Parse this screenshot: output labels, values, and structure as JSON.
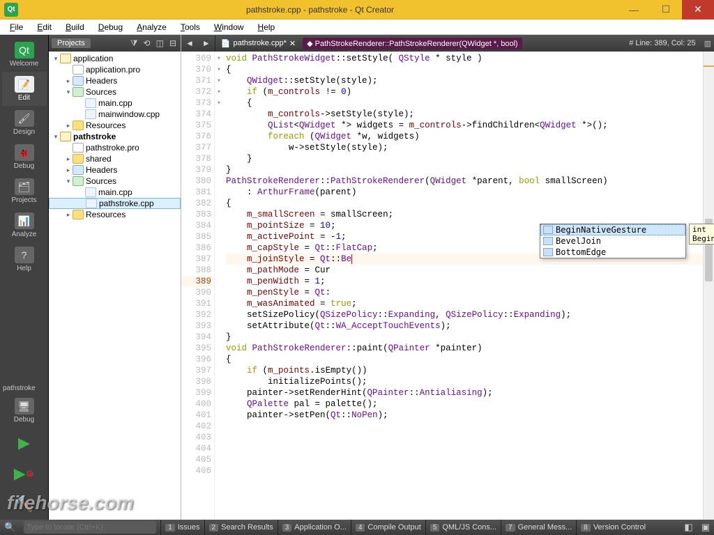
{
  "window": {
    "title": "pathstroke.cpp - pathstroke - Qt Creator"
  },
  "menu": [
    "File",
    "Edit",
    "Build",
    "Debug",
    "Analyze",
    "Tools",
    "Window",
    "Help"
  ],
  "modebar": {
    "items": [
      {
        "label": "Welcome",
        "key": "welcome"
      },
      {
        "label": "Edit",
        "key": "edit",
        "active": true
      },
      {
        "label": "Design",
        "key": "design"
      },
      {
        "label": "Debug",
        "key": "debug"
      },
      {
        "label": "Projects",
        "key": "projects"
      },
      {
        "label": "Analyze",
        "key": "analyze"
      },
      {
        "label": "Help",
        "key": "help"
      }
    ],
    "project_label": "pathstroke",
    "build_config": "Debug"
  },
  "projpanel": {
    "selector": "Projects",
    "tree": [
      {
        "d": 0,
        "t": "application",
        "arr": "▾",
        "ic": "proj"
      },
      {
        "d": 1,
        "t": "application.pro",
        "arr": "",
        "ic": "pro"
      },
      {
        "d": 1,
        "t": "Headers",
        "arr": "▸",
        "ic": "hdr"
      },
      {
        "d": 1,
        "t": "Sources",
        "arr": "▾",
        "ic": "src"
      },
      {
        "d": 2,
        "t": "main.cpp",
        "arr": "",
        "ic": "file"
      },
      {
        "d": 2,
        "t": "mainwindow.cpp",
        "arr": "",
        "ic": "file"
      },
      {
        "d": 1,
        "t": "Resources",
        "arr": "▸",
        "ic": "folder"
      },
      {
        "d": 0,
        "t": "pathstroke",
        "arr": "▾",
        "ic": "proj",
        "bold": true
      },
      {
        "d": 1,
        "t": "pathstroke.pro",
        "arr": "",
        "ic": "pro"
      },
      {
        "d": 1,
        "t": "shared",
        "arr": "▸",
        "ic": "folder"
      },
      {
        "d": 1,
        "t": "Headers",
        "arr": "▸",
        "ic": "hdr"
      },
      {
        "d": 1,
        "t": "Sources",
        "arr": "▾",
        "ic": "src"
      },
      {
        "d": 2,
        "t": "main.cpp",
        "arr": "",
        "ic": "file"
      },
      {
        "d": 2,
        "t": "pathstroke.cpp",
        "arr": "",
        "ic": "file",
        "sel": true
      },
      {
        "d": 1,
        "t": "Resources",
        "arr": "▸",
        "ic": "folder"
      }
    ]
  },
  "editor": {
    "file_tab": "pathstroke.cpp*",
    "symbol": "PathStrokeRenderer::PathStrokeRenderer(QWidget *, bool)",
    "status": "# Line: 389, Col: 25",
    "first_line": 369,
    "cursor_line": 389,
    "folds": {
      "369": "▾",
      "371": "▾",
      "372": "",
      "382": "▾",
      "383": "▾",
      "398": "▾"
    },
    "lines": [
      "void PathStrokeWidget::setStyle( QStyle * style )",
      "{",
      "    QWidget::setStyle(style);",
      "    if (m_controls != 0)",
      "    {",
      "        m_controls->setStyle(style);",
      "",
      "        QList<QWidget *> widgets = m_controls->findChildren<QWidget *>();",
      "        foreach (QWidget *w, widgets)",
      "            w->setStyle(style);",
      "    }",
      "}",
      "",
      "PathStrokeRenderer::PathStrokeRenderer(QWidget *parent, bool smallScreen)",
      "    : ArthurFrame(parent)",
      "{",
      "    m_smallScreen = smallScreen;",
      "    m_pointSize = 10;",
      "    m_activePoint = -1;",
      "    m_capStyle = Qt::FlatCap;",
      "    m_joinStyle = Qt::Be",
      "    m_pathMode = Cur",
      "    m_penWidth = 1;",
      "    m_penStyle = Qt:",
      "    m_wasAnimated = true;",
      "    setSizePolicy(QSizePolicy::Expanding, QSizePolicy::Expanding);",
      "    setAttribute(Qt::WA_AcceptTouchEvents);",
      "}",
      "",
      "void PathStrokeRenderer::paint(QPainter *painter)",
      "{",
      "    if (m_points.isEmpty())",
      "        initializePoints();",
      "",
      "    painter->setRenderHint(QPainter::Antialiasing);",
      "",
      "    QPalette pal = palette();",
      "    painter->setPen(Qt::NoPen);"
    ]
  },
  "autocomplete": {
    "items": [
      "BeginNativeGesture",
      "BevelJoin",
      "BottomEdge"
    ],
    "tooltip": "int BeginNativeGesture"
  },
  "bottombar": {
    "search_placeholder": "Type to locate (Ctrl+K)",
    "panels": [
      {
        "n": "1",
        "l": "Issues"
      },
      {
        "n": "2",
        "l": "Search Results"
      },
      {
        "n": "3",
        "l": "Application O..."
      },
      {
        "n": "4",
        "l": "Compile Output"
      },
      {
        "n": "5",
        "l": "QML/JS Cons..."
      },
      {
        "n": "7",
        "l": "General Mess..."
      },
      {
        "n": "8",
        "l": "Version Control"
      }
    ]
  },
  "watermark": "filehorse.com"
}
